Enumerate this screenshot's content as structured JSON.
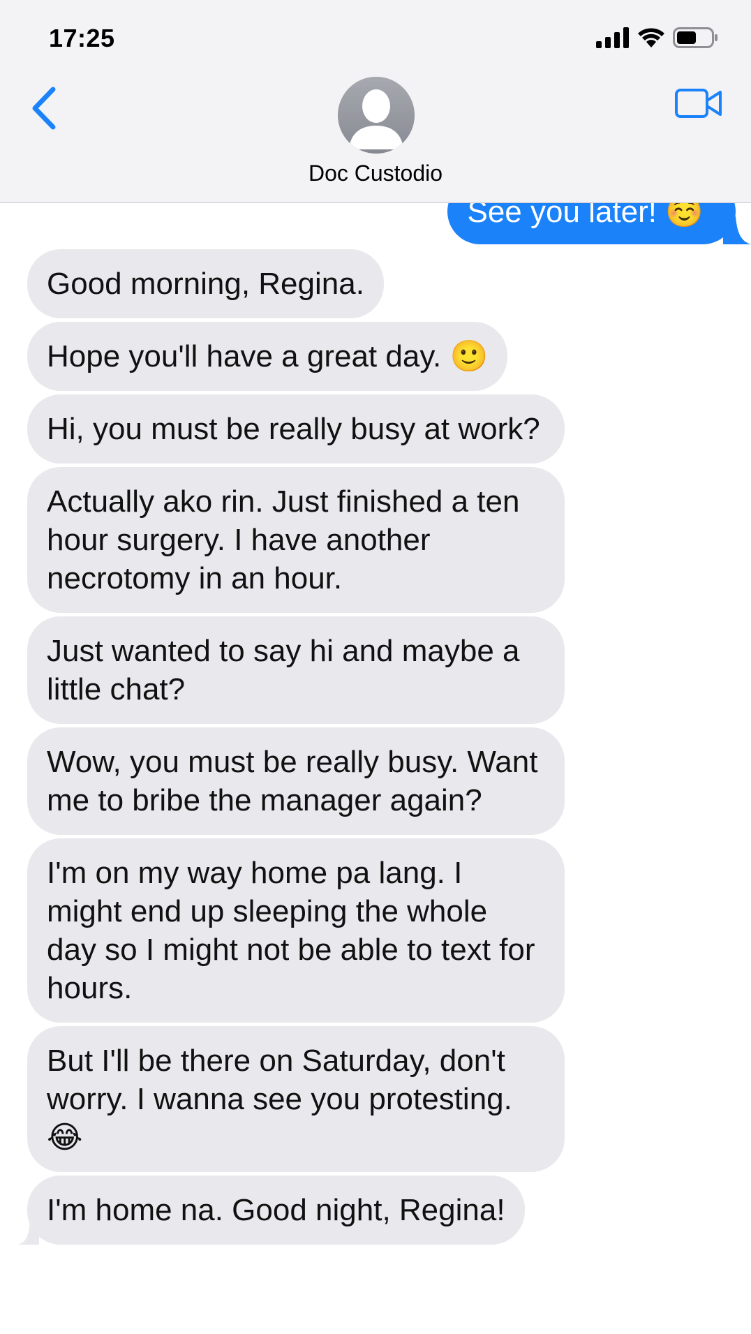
{
  "status_bar": {
    "time": "17:25"
  },
  "header": {
    "contact_name": "Doc Custodio"
  },
  "messages": {
    "sent": [
      {
        "text": "See you later! ☺️"
      }
    ],
    "received": [
      {
        "text": "Good morning, Regina."
      },
      {
        "text": "Hope you'll have a great day. 🙂"
      },
      {
        "text": "Hi, you must be really busy at work?"
      },
      {
        "text": "Actually ako rin. Just finished a ten hour surgery. I have another necrotomy in an hour."
      },
      {
        "text": "Just wanted to say hi and maybe a little chat?"
      },
      {
        "text": "Wow, you must be really busy. Want me to bribe the manager again?"
      },
      {
        "text": "I'm on my way home pa lang. I might end up sleeping the whole day so I might not be able to text for hours."
      },
      {
        "text": "But I'll be there on Saturday, don't worry. I wanna see you protesting. 😂"
      },
      {
        "text": "I'm home na. Good night, Regina!"
      }
    ]
  },
  "colors": {
    "accent_blue": "#1b82f9",
    "received_bubble": "#e9e9ed",
    "header_bg": "#f3f3f6"
  },
  "icons": [
    "back-chevron-icon",
    "video-camera-icon",
    "cellular-signal-icon",
    "wifi-icon",
    "battery-icon",
    "contact-avatar-icon"
  ]
}
